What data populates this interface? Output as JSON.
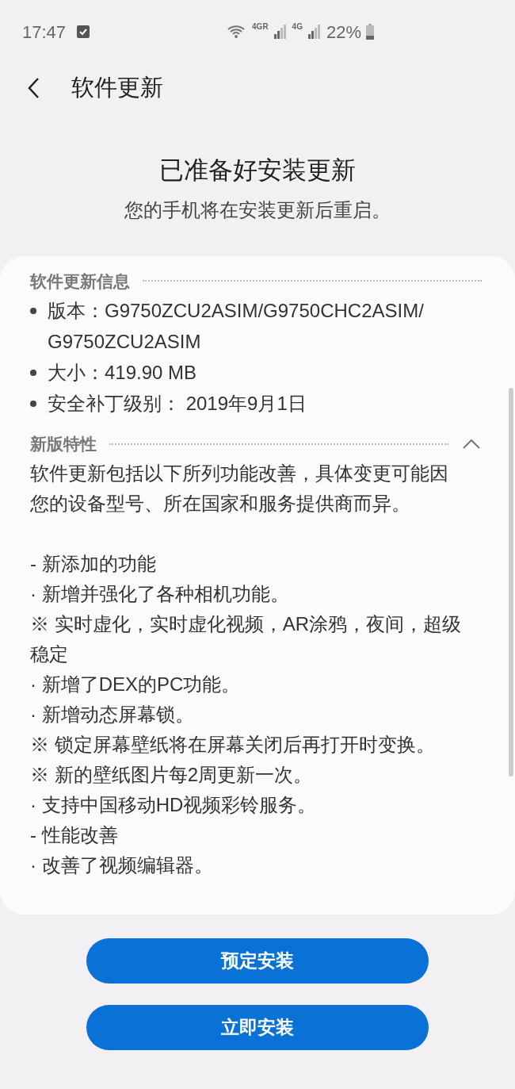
{
  "status_bar": {
    "time": "17:47",
    "network_1": "4GR",
    "network_2": "4G",
    "battery": "22%"
  },
  "header": {
    "title": "软件更新"
  },
  "summary": {
    "title": "已准备好安装更新",
    "subtitle": "您的手机将在安装更新后重启。"
  },
  "info_section": {
    "title": "软件更新信息",
    "items": [
      "版本：G9750ZCU2ASIM/G9750CHC2ASIM/G9750ZCU2ASIM",
      "大小：419.90 MB",
      "安全补丁级别： 2019年9月1日"
    ]
  },
  "features_section": {
    "title": "新版特性",
    "expanded": true,
    "intro": "软件更新包括以下所列功能改善，具体变更可能因您的设备型号、所在国家和服务提供商而异。",
    "lines": [
      "- 新添加的功能",
      "· 新增并强化了各种相机功能。",
      "※ 实时虚化，实时虚化视频，AR涂鸦，夜间，超级稳定",
      "· 新增了DEX的PC功能。",
      "· 新增动态屏幕锁。",
      "※ 锁定屏幕壁纸将在屏幕关闭后再打开时变换。",
      "※ 新的壁纸图片每2周更新一次。",
      "· 支持中国移动HD视频彩铃服务。",
      "- 性能改善",
      "· 改善了视频编辑器。"
    ]
  },
  "buttons": [
    "预定安装",
    "立即安装"
  ]
}
